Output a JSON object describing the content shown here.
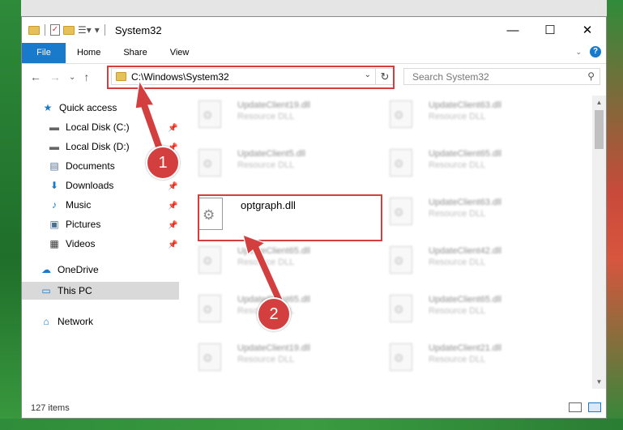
{
  "window": {
    "title": "System32"
  },
  "titlebar": {
    "minimize": "—",
    "maximize": "☐",
    "close": "✕"
  },
  "ribbon": {
    "tabs": [
      "File",
      "Home",
      "Share",
      "View"
    ],
    "help": "?",
    "expand": "⌄"
  },
  "nav": {
    "back": "←",
    "forward": "→",
    "recent": "⌄",
    "up": "↑"
  },
  "address": {
    "path": "C:\\Windows\\System32",
    "dropdown": "⌄",
    "refresh": "↻"
  },
  "search": {
    "placeholder": "Search System32",
    "icon": "search-icon"
  },
  "sidebar": {
    "quick_access": "Quick access",
    "items": [
      {
        "label": "Local Disk (C:)",
        "icon": "drive-icon",
        "pinned": true
      },
      {
        "label": "Local Disk (D:)",
        "icon": "drive-icon",
        "pinned": true
      },
      {
        "label": "Documents",
        "icon": "document-icon",
        "pinned": true
      },
      {
        "label": "Downloads",
        "icon": "download-icon",
        "pinned": true
      },
      {
        "label": "Music",
        "icon": "music-icon",
        "pinned": true
      },
      {
        "label": "Pictures",
        "icon": "pictures-icon",
        "pinned": true
      },
      {
        "label": "Videos",
        "icon": "videos-icon",
        "pinned": true
      }
    ],
    "onedrive": "OneDrive",
    "thispc": "This PC",
    "network": "Network"
  },
  "files": [
    {
      "name": "UpdateClient19.dll",
      "desc": "Resource DLL"
    },
    {
      "name": "UpdateClient63.dll",
      "desc": "Resource DLL"
    },
    {
      "name": "UpdateClient5.dll",
      "desc": "Resource DLL"
    },
    {
      "name": "UpdateClient65.dll",
      "desc": "Resource DLL"
    },
    {
      "name": "UpdateClient63.dll",
      "desc": "Resource DLL"
    },
    {
      "name": "UpdateClient65.dll",
      "desc": "Resource DLL"
    },
    {
      "name": "UpdateClient42.dll",
      "desc": "Resource DLL"
    },
    {
      "name": "UpdateClient65.dll",
      "desc": "Resource DLL"
    },
    {
      "name": "UpdateClient65.dll",
      "desc": "Resource DLL"
    },
    {
      "name": "UpdateClient19.dll",
      "desc": "Resource DLL"
    },
    {
      "name": "UpdateClient21.dll",
      "desc": "Resource DLL"
    }
  ],
  "selected_file": {
    "name": "optgraph.dll"
  },
  "status": {
    "items": "127 items"
  },
  "callouts": [
    "1",
    "2"
  ],
  "colors": {
    "accent": "#1979ca",
    "highlight": "#d33f3f"
  }
}
